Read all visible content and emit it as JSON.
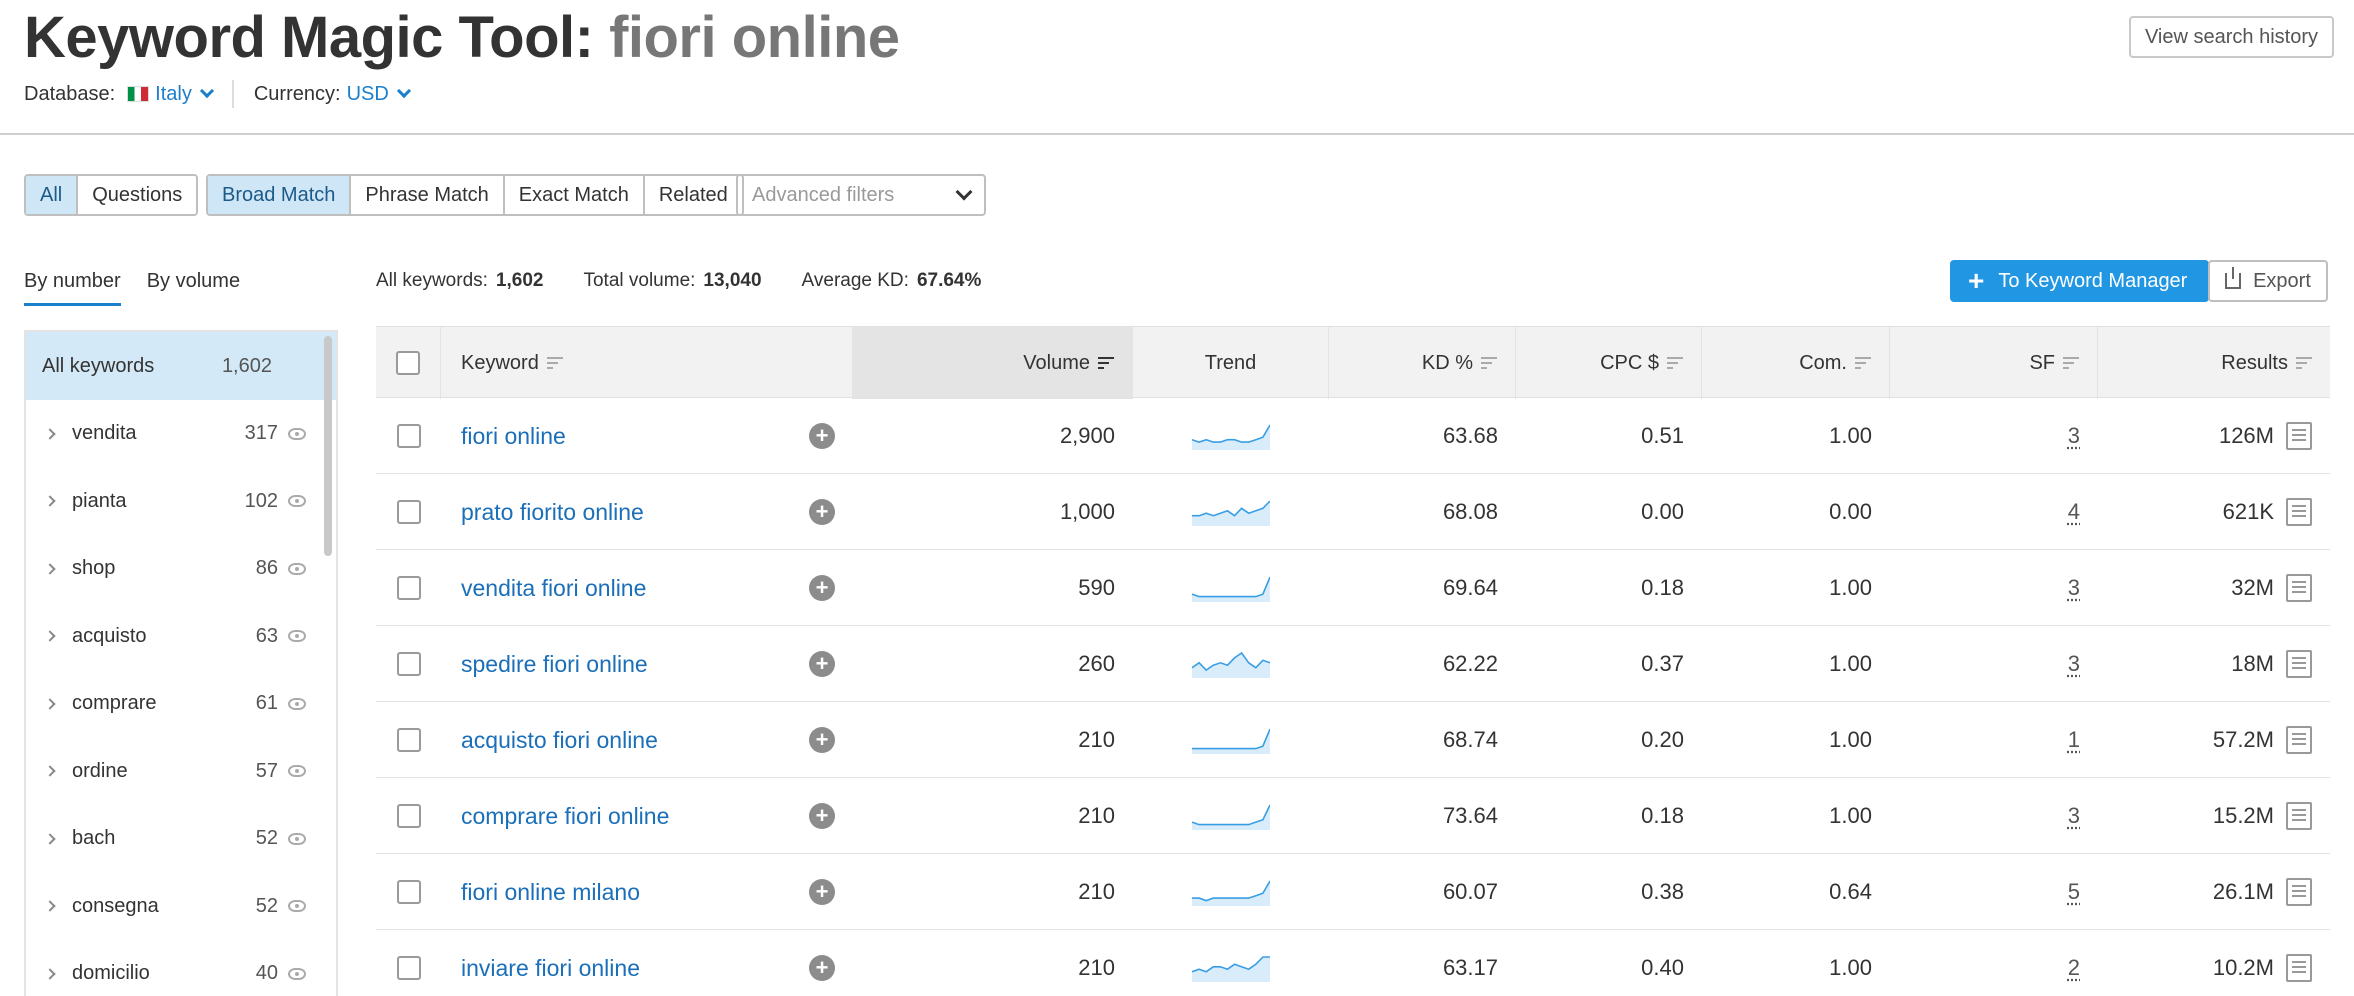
{
  "header": {
    "title_prefix": "Keyword Magic Tool:",
    "title_query": "fiori online",
    "history_button": "View search history",
    "database_label": "Database:",
    "database_value": "Italy",
    "currency_label": "Currency:",
    "currency_value": "USD"
  },
  "filters": {
    "scope_tabs": [
      "All",
      "Questions"
    ],
    "match_tabs": [
      "Broad Match",
      "Phrase Match",
      "Exact Match",
      "Related"
    ],
    "advanced_placeholder": "Advanced filters"
  },
  "sidebar": {
    "tabs": [
      "By number",
      "By volume"
    ],
    "all_label": "All keywords",
    "all_count": "1,602",
    "items": [
      {
        "label": "vendita",
        "count": "317"
      },
      {
        "label": "pianta",
        "count": "102"
      },
      {
        "label": "shop",
        "count": "86"
      },
      {
        "label": "acquisto",
        "count": "63"
      },
      {
        "label": "comprare",
        "count": "61"
      },
      {
        "label": "ordine",
        "count": "57"
      },
      {
        "label": "bach",
        "count": "52"
      },
      {
        "label": "consegna",
        "count": "52"
      },
      {
        "label": "domicilio",
        "count": "40"
      }
    ]
  },
  "summary": {
    "all_label": "All keywords:",
    "all_value": "1,602",
    "volume_label": "Total volume:",
    "volume_value": "13,040",
    "kd_label": "Average KD:",
    "kd_value": "67.64%",
    "keyword_manager_button": "To Keyword Manager",
    "export_button": "Export"
  },
  "table": {
    "columns": {
      "keyword": "Keyword",
      "volume": "Volume",
      "trend": "Trend",
      "kd": "KD %",
      "cpc": "CPC $",
      "com": "Com.",
      "sf": "SF",
      "results": "Results"
    },
    "rows": [
      {
        "keyword": "fiori online",
        "volume": "2,900",
        "kd": "63.68",
        "cpc": "0.51",
        "com": "1.00",
        "sf": "3",
        "results": "126M",
        "trend": [
          3,
          2,
          3,
          2,
          2,
          3,
          3,
          2,
          2,
          3,
          4,
          9
        ]
      },
      {
        "keyword": "prato fiorito online",
        "volume": "1,000",
        "kd": "68.08",
        "cpc": "0.00",
        "com": "0.00",
        "sf": "4",
        "results": "621K",
        "trend": [
          3,
          3,
          4,
          3,
          4,
          5,
          3,
          6,
          4,
          5,
          6,
          9
        ]
      },
      {
        "keyword": "vendita fiori online",
        "volume": "590",
        "kd": "69.64",
        "cpc": "0.18",
        "com": "1.00",
        "sf": "3",
        "results": "32M",
        "trend": [
          2,
          1,
          1,
          1,
          1,
          1,
          1,
          1,
          1,
          1,
          2,
          9
        ]
      },
      {
        "keyword": "spedire fiori online",
        "volume": "260",
        "kd": "62.22",
        "cpc": "0.37",
        "com": "1.00",
        "sf": "3",
        "results": "18M",
        "trend": [
          3,
          5,
          2,
          4,
          5,
          4,
          7,
          9,
          5,
          3,
          6,
          5
        ]
      },
      {
        "keyword": "acquisto fiori online",
        "volume": "210",
        "kd": "68.74",
        "cpc": "0.20",
        "com": "1.00",
        "sf": "1",
        "results": "57.2M",
        "trend": [
          1,
          1,
          1,
          1,
          1,
          1,
          1,
          1,
          1,
          1,
          2,
          9
        ]
      },
      {
        "keyword": "comprare fiori online",
        "volume": "210",
        "kd": "73.64",
        "cpc": "0.18",
        "com": "1.00",
        "sf": "3",
        "results": "15.2M",
        "trend": [
          2,
          1,
          1,
          1,
          1,
          1,
          1,
          1,
          1,
          2,
          3,
          9
        ]
      },
      {
        "keyword": "fiori online milano",
        "volume": "210",
        "kd": "60.07",
        "cpc": "0.38",
        "com": "0.64",
        "sf": "5",
        "results": "26.1M",
        "trend": [
          2,
          2,
          1,
          2,
          2,
          2,
          2,
          2,
          2,
          3,
          4,
          9
        ]
      },
      {
        "keyword": "inviare fiori online",
        "volume": "210",
        "kd": "63.17",
        "cpc": "0.40",
        "com": "1.00",
        "sf": "2",
        "results": "10.2M",
        "trend": [
          3,
          4,
          3,
          5,
          5,
          4,
          6,
          5,
          4,
          6,
          9,
          9
        ]
      }
    ]
  },
  "colors": {
    "accent": "#2196e3",
    "link": "#1b6fb8",
    "trend_line": "#3a9ee4",
    "trend_fill": "#d8ecfa"
  }
}
